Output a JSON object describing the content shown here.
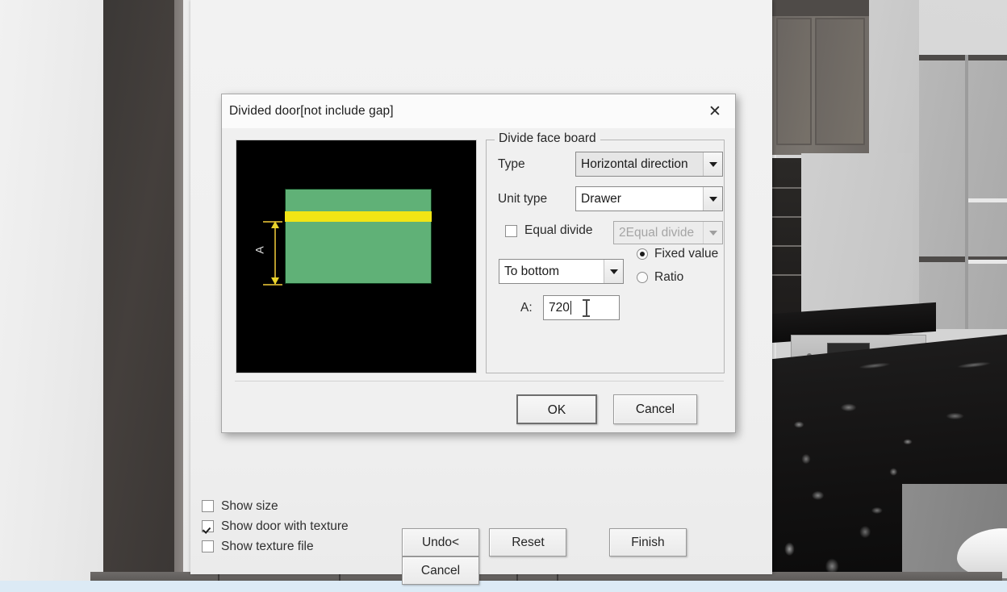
{
  "dialog": {
    "title": "Divided door[not include gap]",
    "close_icon": "close-icon",
    "group_legend": "Divide face board",
    "fields": {
      "type_label": "Type",
      "type_value": "Horizontal direction",
      "unit_type_label": "Unit type",
      "unit_type_value": "Drawer",
      "equal_divide_label": "Equal divide",
      "equal_divide_checked": false,
      "equal_divide_count_value": "2Equal divide",
      "equal_divide_count_enabled": false,
      "reference_value": "To bottom",
      "mode_fixed_label": "Fixed value",
      "mode_ratio_label": "Ratio",
      "mode_selected": "Fixed value",
      "dimension_label": "A:",
      "dimension_value": "720"
    },
    "preview": {
      "dimension_letter": "A",
      "board_color": "#60b177",
      "divider_color": "#f2e515",
      "dimension_color": "#e9d32b",
      "background_color": "#000000"
    },
    "ok_label": "OK",
    "cancel_label": "Cancel"
  },
  "panel": {
    "options": [
      {
        "label": "Show size",
        "checked": false
      },
      {
        "label": "Show door with texture",
        "checked": true
      },
      {
        "label": "Show texture file",
        "checked": false
      }
    ],
    "buttons": {
      "undo": "Undo<",
      "reset": "Reset",
      "finish": "Finish",
      "cancel": "Cancel"
    }
  }
}
